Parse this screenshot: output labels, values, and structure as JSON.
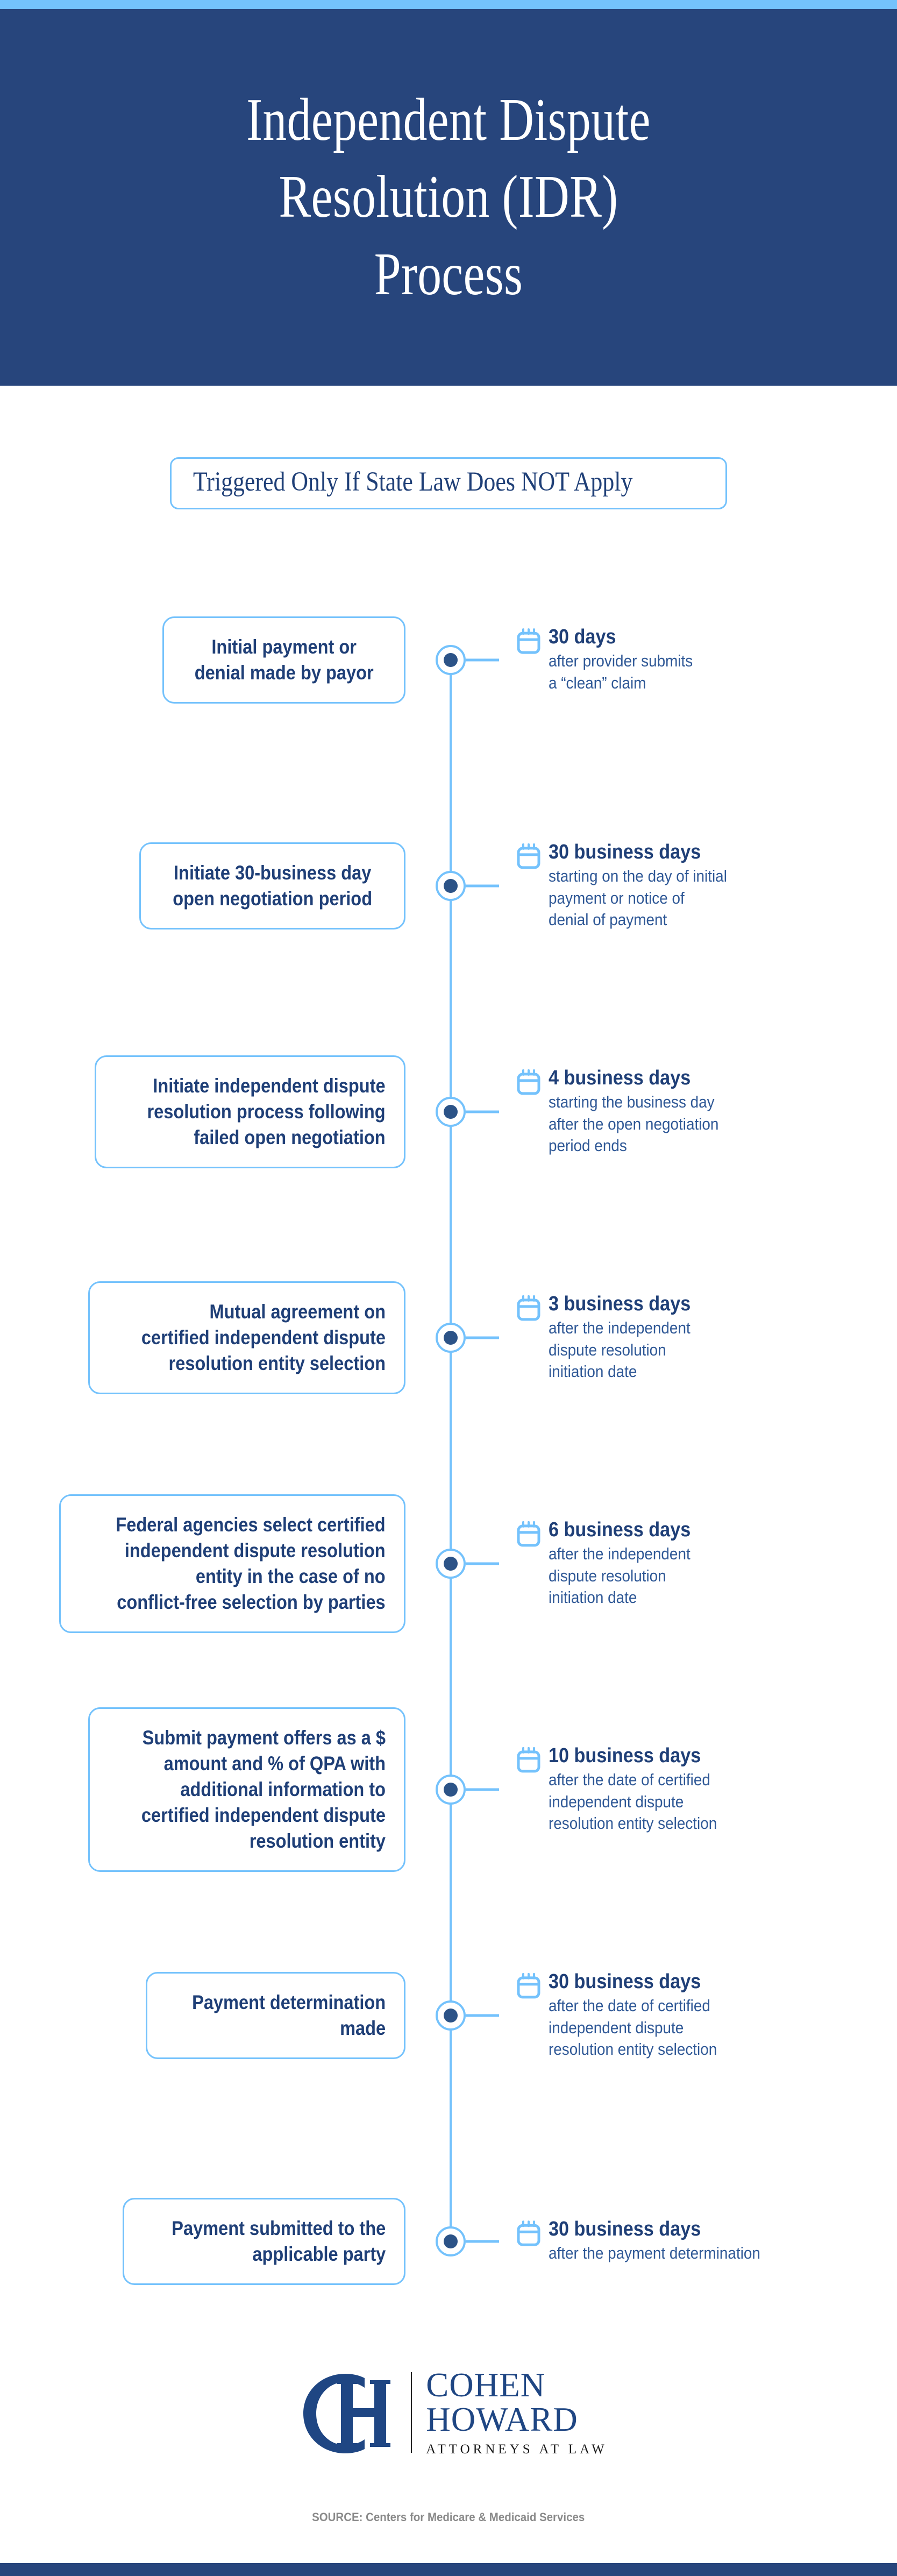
{
  "colors": {
    "accent_light_blue": "#74c2fc",
    "navy": "#27457c",
    "text_navy": "#1f3f77",
    "text_body_blue": "#2f5896",
    "dot_navy": "#2c5387",
    "source_gray": "#8a8a8a",
    "logo_blue": "#1f4683",
    "white": "#ffffff"
  },
  "header": {
    "title": "Independent Dispute\nResolution (IDR)\nProcess"
  },
  "banner": {
    "text": "Triggered Only If State Law Does NOT Apply"
  },
  "timeline": {
    "steps": [
      {
        "step": "Initial payment or\ndenial made by payor",
        "align": "center",
        "icon": "calendar-icon",
        "duration": "30 days",
        "detail": "after provider submits\na “clean” claim"
      },
      {
        "step": "Initiate 30-business day\nopen negotiation period",
        "align": "center",
        "icon": "calendar-icon",
        "duration": "30 business days",
        "detail": "starting on the day of initial\npayment or notice of\ndenial of payment"
      },
      {
        "step": "Initiate independent dispute\nresolution process following\nfailed open negotiation",
        "align": "right",
        "icon": "calendar-icon",
        "duration": "4 business days",
        "detail": "starting the business day\nafter the open negotiation\nperiod ends"
      },
      {
        "step": "Mutual agreement on\ncertified independent dispute\nresolution entity selection",
        "align": "right",
        "icon": "calendar-icon",
        "duration": "3 business days",
        "detail": "after the independent\ndispute resolution\ninitiation date"
      },
      {
        "step": "Federal agencies select certified\nindependent dispute resolution\nentity in the case of no\nconflict-free selection by parties",
        "align": "right",
        "icon": "calendar-icon",
        "duration": "6 business days",
        "detail": "after the independent\ndispute resolution\ninitiation date"
      },
      {
        "step": "Submit payment offers as a $\namount and % of QPA with\nadditional information to\ncertified independent dispute\nresolution entity",
        "align": "right",
        "icon": "calendar-icon",
        "duration": "10 business days",
        "detail": "after the date of certified\nindependent dispute\nresolution entity selection"
      },
      {
        "step": "Payment determination\nmade",
        "align": "right",
        "icon": "calendar-icon",
        "duration": "30 business days",
        "detail": "after the date of certified\nindependent dispute\nresolution entity selection"
      },
      {
        "step": "Payment submitted to the\napplicable party",
        "align": "right",
        "icon": "calendar-icon",
        "duration": "30 business days",
        "detail": "after the payment determination"
      }
    ]
  },
  "footer": {
    "logo_monogram": "CH",
    "logo_line1": "COHEN",
    "logo_line2": "HOWARD",
    "logo_tagline": "ATTORNEYS AT LAW",
    "source": "SOURCE: Centers for Medicare & Medicaid Services"
  }
}
